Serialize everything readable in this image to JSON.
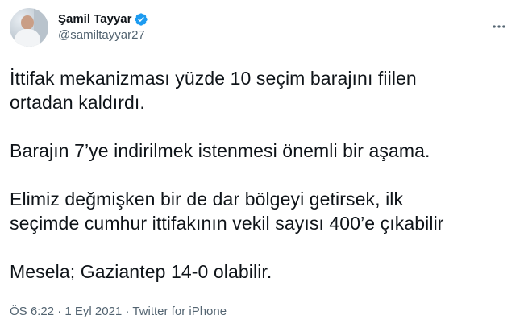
{
  "author": {
    "display_name": "Şamil Tayyar",
    "handle": "@samiltayyar27",
    "verified_icon": "verified-badge-icon",
    "avatar": "profile-photo"
  },
  "tweet": {
    "paragraphs": [
      "İttifak mekanizması yüzde 10 seçim barajını fiilen\nortadan kaldırdı.",
      "Barajın 7’ye indirilmek istenmesi önemli bir aşama.",
      "Elimiz değmişken bir de dar bölgeyi getirsek, ilk\nseçimde cumhur ittifakının vekil sayısı 400’e çıkabilir",
      "Mesela; Gaziantep 14-0 olabilir."
    ]
  },
  "meta": {
    "time": "ÖS 6:22",
    "separator1": " · ",
    "date": "1 Eyl 2021",
    "separator2": " · ",
    "source": "Twitter for iPhone"
  },
  "colors": {
    "text": "#0f1419",
    "secondary": "#536471",
    "verified": "#1d9bf0"
  }
}
